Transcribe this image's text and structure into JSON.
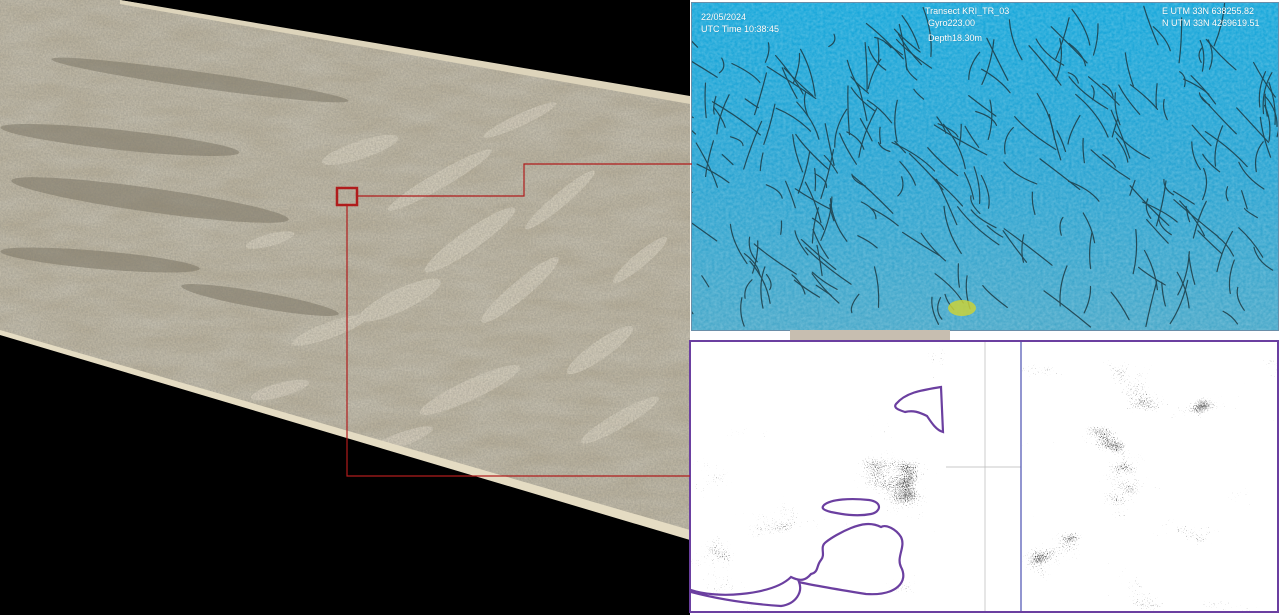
{
  "photo_overlay": {
    "date": "22/05/2024",
    "utc_time": "UTC Time 10:38:45",
    "transect": "Transect KRI_TR_03",
    "gyro": "Gyro223.00",
    "depth": "Depth18.30m",
    "easting": "E UTM 33N 638255.82",
    "northing": "N UTM 33N 4269619.51"
  },
  "colors": {
    "connector": "#b01c1c",
    "sonar_border": "#6b3fa0",
    "water": "#1fa3d4",
    "seabed_mosaic": "#b9b09a"
  }
}
